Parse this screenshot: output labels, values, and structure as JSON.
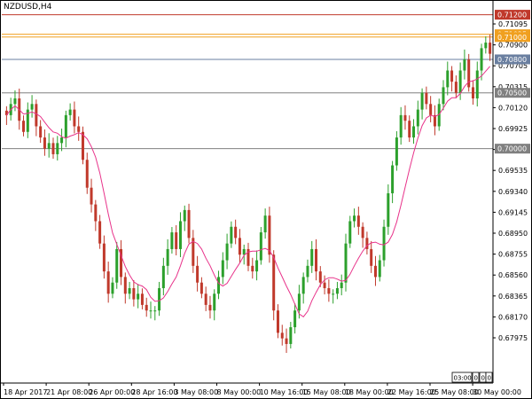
{
  "window": {
    "symbol_label": "NZDUSD,H4"
  },
  "colors": {
    "background": "#ffffff",
    "axis": "#000000",
    "bull": "#2ca02c",
    "bear": "#c0392b",
    "ma": "#e8338a",
    "line_red": "#c0392b",
    "line_orange": "#f0a020",
    "line_blue": "#6a7fa0",
    "line_gray": "#808080"
  },
  "chart_data": {
    "type": "candlestick",
    "symbol": "NZDUSD",
    "timeframe": "H4",
    "ylim": [
      0.679,
      0.713
    ],
    "y_ticks": [
      "0.71095",
      "0.70900",
      "0.70705",
      "0.70315",
      "0.70120",
      "0.69925",
      "0.69730",
      "0.69535",
      "0.69340",
      "0.69145",
      "0.68950",
      "0.68755",
      "0.68560",
      "0.68365",
      "0.68170",
      "0.67975"
    ],
    "x_tick_labels": [
      "18 Apr 2017",
      "21 Apr 08:00",
      "26 Apr 00:00",
      "28 Apr 16:00",
      "3 May 08:00",
      "8 May 00:00",
      "10 May 16:00",
      "15 May 08:00",
      "18 May 00:00",
      "22 May 16:00",
      "25 May 08:00",
      "30 May 00:00"
    ],
    "price_lines": [
      {
        "label": "0.71200",
        "value": 0.712,
        "color": "#c0392b"
      },
      {
        "label": "0.71025",
        "value": 0.71025,
        "color": "#f0a020"
      },
      {
        "label": "0.71000",
        "value": 0.71,
        "color": "#f0a020"
      },
      {
        "label": "0.70800",
        "value": 0.708,
        "color": "#6a7fa0"
      },
      {
        "label": "0.70500",
        "value": 0.705,
        "color": "#808080"
      },
      {
        "label": "0.70000",
        "value": 0.7,
        "color": "#808080"
      }
    ],
    "hidden_markers": [
      "03:00",
      "0",
      "0",
      "0"
    ],
    "close_path": [
      0.703,
      0.704,
      0.7045,
      0.7025,
      0.7015,
      0.7035,
      0.704,
      0.702,
      0.701,
      0.7,
      0.7005,
      0.6995,
      0.7005,
      0.701,
      0.703,
      0.7035,
      0.702,
      0.7015,
      0.699,
      0.6965,
      0.695,
      0.6935,
      0.6915,
      0.689,
      0.687,
      0.688,
      0.691,
      0.6885,
      0.687,
      0.6875,
      0.6865,
      0.687,
      0.686,
      0.6855,
      0.6855,
      0.6855,
      0.6875,
      0.6895,
      0.691,
      0.6925,
      0.691,
      0.6935,
      0.6945,
      0.692,
      0.6895,
      0.688,
      0.687,
      0.686,
      0.6855,
      0.687,
      0.6885,
      0.69,
      0.6915,
      0.693,
      0.692,
      0.6905,
      0.691,
      0.6895,
      0.689,
      0.69,
      0.6925,
      0.694,
      0.6905,
      0.6855,
      0.6835,
      0.683,
      0.6825,
      0.684,
      0.6855,
      0.687,
      0.6885,
      0.6895,
      0.691,
      0.689,
      0.688,
      0.6875,
      0.687,
      0.687,
      0.6875,
      0.688,
      0.6915,
      0.6935,
      0.694,
      0.693,
      0.692,
      0.691,
      0.6895,
      0.6885,
      0.69,
      0.693,
      0.696,
      0.6985,
      0.701,
      0.703,
      0.7025,
      0.701,
      0.702,
      0.7035,
      0.705,
      0.704,
      0.703,
      0.702,
      0.704,
      0.7055,
      0.707,
      0.706,
      0.705,
      0.707,
      0.708,
      0.7055,
      0.7045,
      0.707,
      0.709,
      0.7095,
      0.7085
    ]
  }
}
